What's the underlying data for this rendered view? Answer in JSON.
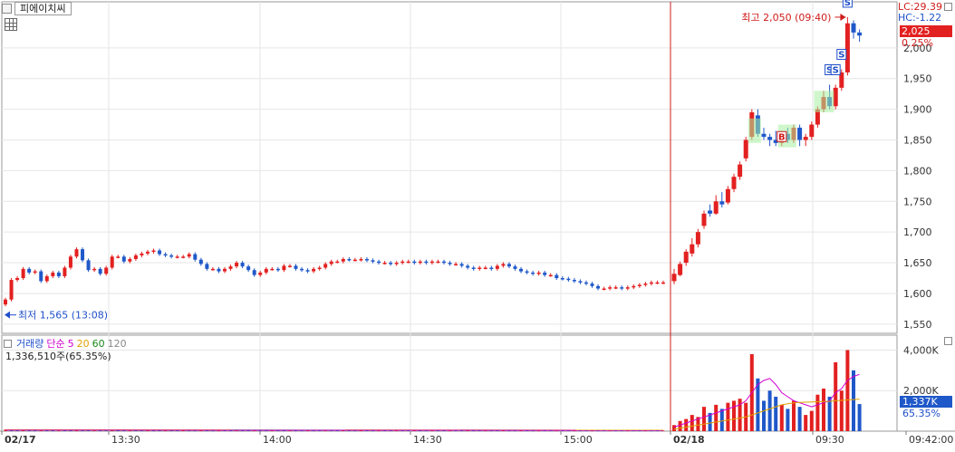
{
  "window": {
    "stock_name": "피에이치씨"
  },
  "header": {
    "lc": "LC:29.39",
    "hc": "HC:-1.22"
  },
  "price_tag": {
    "value": "2,025",
    "pct": "0.25%"
  },
  "annotations": {
    "high": "최고 2,050 (09:40)",
    "low": "최저 1,565 (13:08)"
  },
  "volume_panel": {
    "label": "거래량",
    "ma_label": "단순",
    "ma_periods": [
      "5",
      "20",
      "60",
      "120"
    ],
    "ma_colors": [
      "#d000d0",
      "#e0a000",
      "#1b8a1b",
      "#888888"
    ],
    "summary": "1,336,510주(65.35%)",
    "tag_value": "1,337K",
    "tag_pct": "65.35%"
  },
  "colors": {
    "up": "#e32020",
    "down": "#1f58c9",
    "accent": "#d01c1c"
  },
  "chart_data": [
    {
      "type": "candlestick",
      "title": "",
      "y_axis_labels": [
        "1,550",
        "1,600",
        "1,650",
        "1,700",
        "1,750",
        "1,800",
        "1,850",
        "1,900",
        "1,950",
        "2,000"
      ],
      "ylim": [
        1535,
        2075
      ],
      "x_axis_labels": [
        "02/17",
        "13:30",
        "14:00",
        "14:30",
        "15:00",
        "02/18",
        "09:30",
        "09:42:00"
      ],
      "day_separator": "02/18",
      "close_series": [
        1590,
        1622,
        1625,
        1640,
        1634,
        1636,
        1620,
        1628,
        1634,
        1628,
        1642,
        1660,
        1672,
        1654,
        1638,
        1640,
        1632,
        1642,
        1660,
        1660,
        1652,
        1656,
        1662,
        1665,
        1668,
        1670,
        1664,
        1662,
        1660,
        1660,
        1660,
        1664,
        1655,
        1648,
        1640,
        1640,
        1636,
        1640,
        1644,
        1650,
        1644,
        1638,
        1630,
        1634,
        1640,
        1640,
        1638,
        1645,
        1645,
        1640,
        1638,
        1636,
        1640,
        1642,
        1648,
        1652,
        1652,
        1656,
        1655,
        1655,
        1656,
        1654,
        1652,
        1650,
        1650,
        1648,
        1650,
        1652,
        1652,
        1650,
        1652,
        1650,
        1652,
        1652,
        1650,
        1648,
        1648,
        1645,
        1642,
        1640,
        1642,
        1642,
        1640,
        1645,
        1648,
        1644,
        1640,
        1636,
        1634,
        1632,
        1634,
        1630,
        1630,
        1625,
        1624,
        1622,
        1620,
        1618,
        1616,
        1612,
        1608,
        1608,
        1610,
        1610,
        1608,
        1610,
        1612,
        1614,
        1616,
        1618,
        1618,
        1618
      ],
      "session2_candles": [
        {
          "o": 1620,
          "c": 1632,
          "h": 1640,
          "l": 1615
        },
        {
          "o": 1630,
          "c": 1648,
          "h": 1652,
          "l": 1628
        },
        {
          "o": 1650,
          "c": 1668,
          "h": 1672,
          "l": 1645
        },
        {
          "o": 1665,
          "c": 1680,
          "h": 1690,
          "l": 1660
        },
        {
          "o": 1680,
          "c": 1700,
          "h": 1705,
          "l": 1675
        },
        {
          "o": 1710,
          "c": 1730,
          "h": 1735,
          "l": 1705
        },
        {
          "o": 1735,
          "c": 1730,
          "h": 1745,
          "l": 1725
        },
        {
          "o": 1730,
          "c": 1750,
          "h": 1760,
          "l": 1728
        },
        {
          "o": 1750,
          "c": 1745,
          "h": 1765,
          "l": 1740
        },
        {
          "o": 1748,
          "c": 1770,
          "h": 1775,
          "l": 1745
        },
        {
          "o": 1770,
          "c": 1790,
          "h": 1795,
          "l": 1765
        },
        {
          "o": 1790,
          "c": 1810,
          "h": 1815,
          "l": 1785
        },
        {
          "o": 1820,
          "c": 1850,
          "h": 1855,
          "l": 1815
        },
        {
          "o": 1855,
          "c": 1895,
          "h": 1900,
          "l": 1850
        },
        {
          "o": 1890,
          "c": 1860,
          "h": 1900,
          "l": 1855
        },
        {
          "o": 1860,
          "c": 1855,
          "h": 1870,
          "l": 1850
        },
        {
          "o": 1855,
          "c": 1850,
          "h": 1860,
          "l": 1840
        },
        {
          "o": 1850,
          "c": 1845,
          "h": 1865,
          "l": 1840
        },
        {
          "o": 1845,
          "c": 1860,
          "h": 1865,
          "l": 1840
        },
        {
          "o": 1860,
          "c": 1850,
          "h": 1870,
          "l": 1845
        },
        {
          "o": 1850,
          "c": 1870,
          "h": 1875,
          "l": 1845
        },
        {
          "o": 1870,
          "c": 1850,
          "h": 1875,
          "l": 1840
        },
        {
          "o": 1850,
          "c": 1855,
          "h": 1860,
          "l": 1840
        },
        {
          "o": 1855,
          "c": 1875,
          "h": 1880,
          "l": 1850
        },
        {
          "o": 1875,
          "c": 1900,
          "h": 1905,
          "l": 1870
        },
        {
          "o": 1900,
          "c": 1920,
          "h": 1930,
          "l": 1895
        },
        {
          "o": 1920,
          "c": 1905,
          "h": 1940,
          "l": 1900
        },
        {
          "o": 1905,
          "c": 1935,
          "h": 1940,
          "l": 1900
        },
        {
          "o": 1935,
          "c": 1960,
          "h": 1965,
          "l": 1930
        },
        {
          "o": 1960,
          "c": 2040,
          "h": 2050,
          "l": 1955
        },
        {
          "o": 2040,
          "c": 2025,
          "h": 2045,
          "l": 2015
        },
        {
          "o": 2025,
          "c": 2020,
          "h": 2030,
          "l": 2010
        }
      ],
      "signals": [
        {
          "label": "B",
          "candle": 18
        },
        {
          "label": "S",
          "candle": 26
        },
        {
          "label": "S",
          "candle": 27
        },
        {
          "label": "S",
          "candle": 28
        },
        {
          "label": "S",
          "candle": 29
        }
      ]
    },
    {
      "type": "bar",
      "title": "",
      "y_axis_labels": [
        "4,000K",
        "2,000K"
      ],
      "ylim": [
        0,
        4200
      ],
      "session1_volume": [
        80,
        60,
        40,
        50,
        60,
        40,
        30,
        40,
        50,
        30,
        40,
        60,
        70,
        40,
        30,
        30,
        40,
        30,
        40,
        50,
        30,
        40,
        30,
        30,
        40,
        50,
        40,
        30,
        40,
        30,
        30,
        40,
        30,
        30,
        40,
        30,
        30,
        40,
        30,
        30,
        40,
        30,
        30,
        30,
        40,
        30,
        30,
        40,
        30,
        30,
        40,
        30,
        30,
        30,
        40,
        30,
        30,
        30,
        40,
        30,
        30,
        30,
        40,
        30,
        30,
        30,
        40,
        30,
        30,
        40,
        30,
        30,
        30,
        40,
        30,
        30,
        30,
        40,
        30,
        30,
        30,
        40,
        30,
        30,
        30,
        40,
        30,
        30,
        40,
        30,
        30,
        30,
        40,
        30,
        30,
        30,
        40,
        30,
        30,
        40,
        30,
        30,
        30,
        40,
        30,
        30,
        30,
        40,
        30,
        30,
        40,
        30
      ],
      "session2_volume": [
        300,
        500,
        600,
        800,
        700,
        1200,
        900,
        1300,
        1100,
        1400,
        1500,
        1600,
        1400,
        3800,
        2600,
        1500,
        2000,
        1700,
        1300,
        1100,
        1500,
        1200,
        800,
        1000,
        1800,
        2100,
        1700,
        3400,
        2000,
        4000,
        3000,
        1337
      ],
      "ma5_session2": [
        200,
        300,
        400,
        500,
        600,
        700,
        800,
        900,
        1000,
        1100,
        1200,
        1300,
        1500,
        1900,
        2300,
        2500,
        2600,
        2300,
        1900,
        1700,
        1500,
        1400,
        1300,
        1200,
        1300,
        1400,
        1500,
        1900,
        2100,
        2500,
        2700,
        2800
      ],
      "ma20_session2": [
        100,
        150,
        200,
        250,
        300,
        350,
        400,
        450,
        500,
        550,
        600,
        650,
        700,
        800,
        900,
        1000,
        1100,
        1200,
        1300,
        1350,
        1400,
        1420,
        1430,
        1440,
        1450,
        1460,
        1470,
        1500,
        1520,
        1540,
        1560,
        1580
      ]
    }
  ]
}
